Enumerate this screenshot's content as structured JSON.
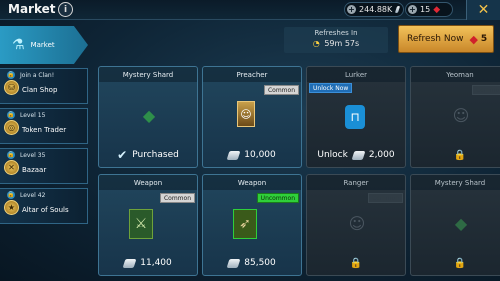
{
  "header": {
    "title": "Market",
    "info_icon": "i",
    "silver": "244.88K",
    "gems": "15",
    "close_icon": "✕"
  },
  "refresh": {
    "label": "Refreshes In",
    "time": "59m 57s",
    "button_label": "Refresh Now",
    "cost": "5"
  },
  "sidebar": {
    "market_label": "Market",
    "items": [
      {
        "level": "Join a Clan!",
        "name": "Clan Shop"
      },
      {
        "level": "Level 15",
        "name": "Token Trader"
      },
      {
        "level": "Level 35",
        "name": "Bazaar"
      },
      {
        "level": "Level 42",
        "name": "Altar of Souls"
      }
    ]
  },
  "cards": [
    {
      "title": "Mystery Shard",
      "status": "Purchased",
      "tag": "",
      "icon": "shard-icon"
    },
    {
      "title": "Preacher",
      "price": "10,000",
      "tag": "Common",
      "icon": "champion-portrait"
    },
    {
      "title": "Lurker",
      "price": "2,000",
      "status": "Unlock",
      "tag": "Unlock Now",
      "icon": "lock-icon"
    },
    {
      "title": "Yeoman",
      "tag": "",
      "icon": "champion-portrait"
    },
    {
      "title": "Weapon",
      "price": "11,400",
      "tag": "Common",
      "icon": "weapon-icon"
    },
    {
      "title": "Weapon",
      "price": "85,500",
      "tag": "Uncommon",
      "icon": "weapon-icon"
    },
    {
      "title": "Ranger",
      "tag": "",
      "icon": "champion-portrait"
    },
    {
      "title": "Mystery Shard",
      "tag": "",
      "icon": "shard-icon"
    }
  ],
  "colors": {
    "accent_gold": "#f2c25a",
    "common_tag": "#d5d5d5",
    "uncommon_tag": "#2fcf3a",
    "selected_tab": "#2a9bc4"
  }
}
